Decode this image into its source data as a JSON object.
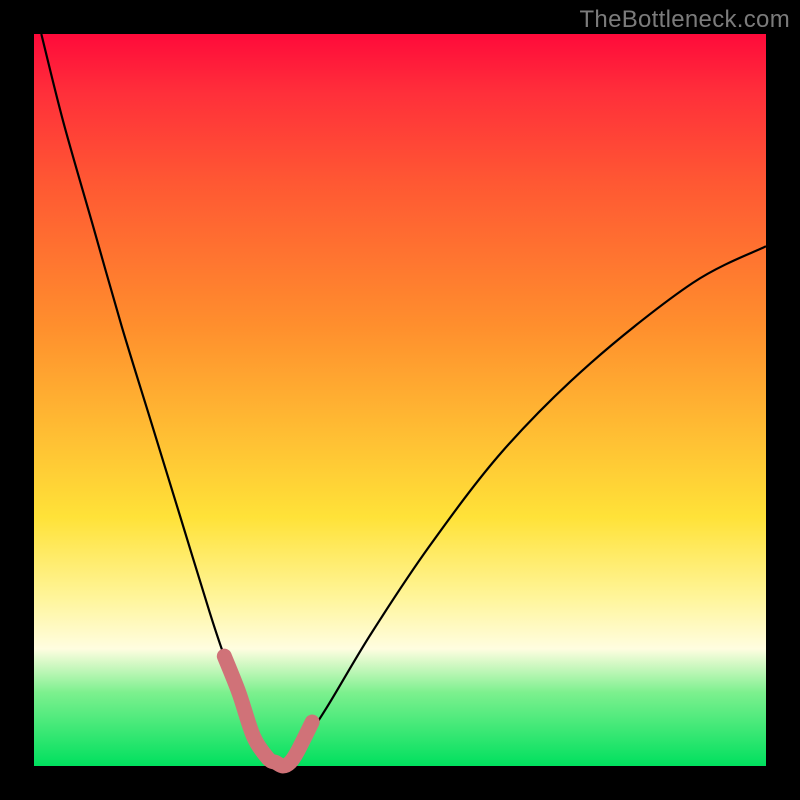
{
  "watermark": "TheBottleneck.com",
  "chart_data": {
    "type": "line",
    "title": "",
    "xlabel": "",
    "ylabel": "",
    "xlim": [
      0,
      100
    ],
    "ylim": [
      0,
      100
    ],
    "series": [
      {
        "name": "bottleneck-curve",
        "x": [
          1,
          4,
          8,
          12,
          16,
          20,
          24,
          26,
          28,
          30,
          32,
          34,
          36,
          40,
          46,
          54,
          64,
          76,
          90,
          100
        ],
        "values": [
          100,
          88,
          74,
          60,
          47,
          34,
          21,
          15,
          10,
          4,
          1,
          0,
          2,
          8,
          18,
          30,
          43,
          55,
          66,
          71
        ]
      }
    ],
    "highlight": {
      "name": "optimal-range",
      "x": [
        26,
        28,
        30,
        32,
        33,
        34,
        35,
        36,
        38
      ],
      "values": [
        15,
        10,
        4,
        1,
        0.5,
        0,
        0.5,
        2,
        6
      ]
    },
    "background_gradient": [
      "#ff0a3a",
      "#ffe238",
      "#00e05e"
    ]
  }
}
